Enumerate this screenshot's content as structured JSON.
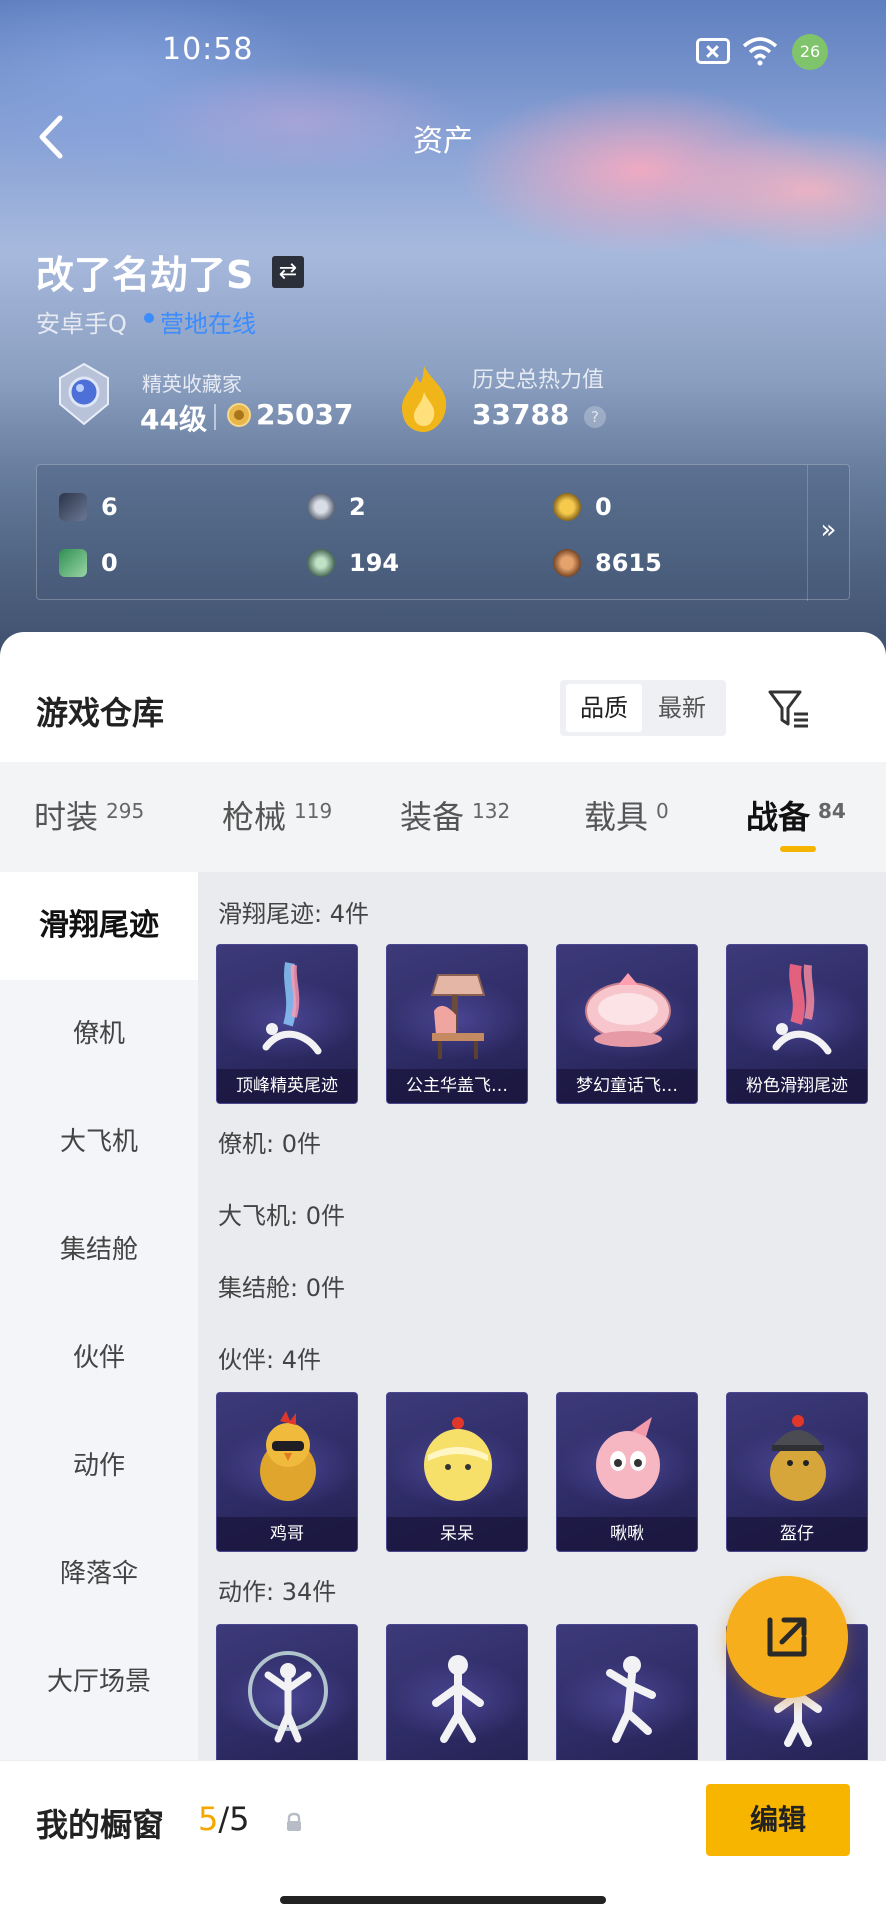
{
  "status_bar": {
    "time": "10:58",
    "battery": "26"
  },
  "header": {
    "title": "资产"
  },
  "profile": {
    "name": "改了名劫了S",
    "platform": "安卓手Q",
    "online_status": "营地在线",
    "level_title": "精英收藏家",
    "level": "44级",
    "coins": "25037",
    "heat_title": "历史总热力值",
    "heat_value": "33788",
    "help_glyph": "?"
  },
  "currencies": [
    {
      "icon": "card-icon",
      "value": "6"
    },
    {
      "icon": "silver-coin-icon",
      "value": "2"
    },
    {
      "icon": "gold-token-icon",
      "value": "0"
    },
    {
      "icon": "ticket-icon",
      "value": "0"
    },
    {
      "icon": "green-orb-icon",
      "value": "194"
    },
    {
      "icon": "bronze-coin-icon",
      "value": "8615"
    }
  ],
  "currency_more": "»",
  "warehouse": {
    "title": "游戏仓库",
    "sort_options": [
      "品质",
      "最新"
    ],
    "active_sort": "品质"
  },
  "tabs": [
    {
      "label": "时装",
      "count": "295"
    },
    {
      "label": "枪械",
      "count": "119"
    },
    {
      "label": "装备",
      "count": "132"
    },
    {
      "label": "载具",
      "count": "0"
    },
    {
      "label": "战备",
      "count": "84"
    }
  ],
  "active_tab": "战备",
  "side_nav": [
    "滑翔尾迹",
    "僚机",
    "大飞机",
    "集结舱",
    "伙伴",
    "动作",
    "降落伞",
    "大厅场景"
  ],
  "sections": [
    {
      "title": "滑翔尾迹: 4件",
      "items": [
        "顶峰精英尾迹",
        "公主华盖飞…",
        "梦幻童话飞…",
        "粉色滑翔尾迹"
      ]
    },
    {
      "title": "僚机: 0件",
      "items": []
    },
    {
      "title": "大飞机: 0件",
      "items": []
    },
    {
      "title": "集结舱: 0件",
      "items": []
    },
    {
      "title": "伙伴: 4件",
      "items": [
        "鸡哥",
        "呆呆",
        "啾啾",
        "盔仔"
      ]
    },
    {
      "title": "动作: 34件",
      "items": [
        "",
        "",
        "",
        ""
      ]
    }
  ],
  "showcase": {
    "label": "我的橱窗",
    "count_current": "5",
    "count_sep_total": "/5",
    "edit_label": "编辑"
  },
  "colors": {
    "accent": "#f7b500",
    "online": "#3a8cff",
    "card_bg": "#2e2c66"
  }
}
